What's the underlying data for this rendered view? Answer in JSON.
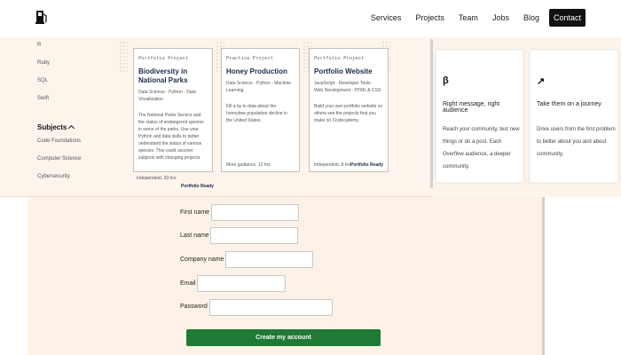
{
  "navbar": {
    "logo_icon": "fuel-pump-icon",
    "links": [
      "Services",
      "Projects",
      "Team",
      "Jobs",
      "Blog"
    ],
    "cta": "Contact"
  },
  "sidebar": {
    "items": [
      "R",
      "Ruby",
      "SQL",
      "Swift"
    ],
    "subjects_heading": "Subjects",
    "subjects": [
      "Code Foundations",
      "Computer Science",
      "Cybersecurity"
    ]
  },
  "project_cards": [
    {
      "kicker": "Portfolio Project",
      "title": "Biodiversity in National Parks",
      "tags": "Data Science · Python · Data Visualization",
      "desc": "The National Parks Service and the status of endangered species in some of the parks. Use your Python and data skills to better understand the status of various species. This could uncover subjects with changing projects.",
      "meta": "Independent, 33 hrs",
      "ready": "Portfolio Ready"
    },
    {
      "kicker": "Practice Project",
      "title": "Honey Production",
      "tags": "Data Science · Python · Machine Learning",
      "desc": "Fill a by to data about the honeybee population decline in the United States.",
      "meta": "More guidance, 12 hrs",
      "ready": ""
    },
    {
      "kicker": "Portfolio Project",
      "title": "Portfolio Website",
      "tags": "JavaScript · Developer Tools · Web Development · HTML & CSS",
      "desc": "Build your own portfolio website so others see the projects that you make on Codecademy.",
      "meta": "Independent, 8 hrs",
      "ready": "Portfolio Ready"
    }
  ],
  "right_cards": [
    {
      "glyph": "β",
      "title": "Right message, right audience",
      "text": "Reach your community, test new things or do a post. Each Overflow audience, a deeper community."
    },
    {
      "glyph": "↗",
      "title": "Take them on a journey",
      "text": "Drive users from the first problem to better about you and about community."
    }
  ],
  "form": {
    "fields": [
      "First name",
      "Last name",
      "Company name",
      "Email",
      "Password"
    ],
    "submit": "Create my account"
  },
  "colors": {
    "band": "#fdf4ec",
    "form_bg": "#fdf2e8",
    "submit": "#1e7a34",
    "cta": "#111111"
  }
}
